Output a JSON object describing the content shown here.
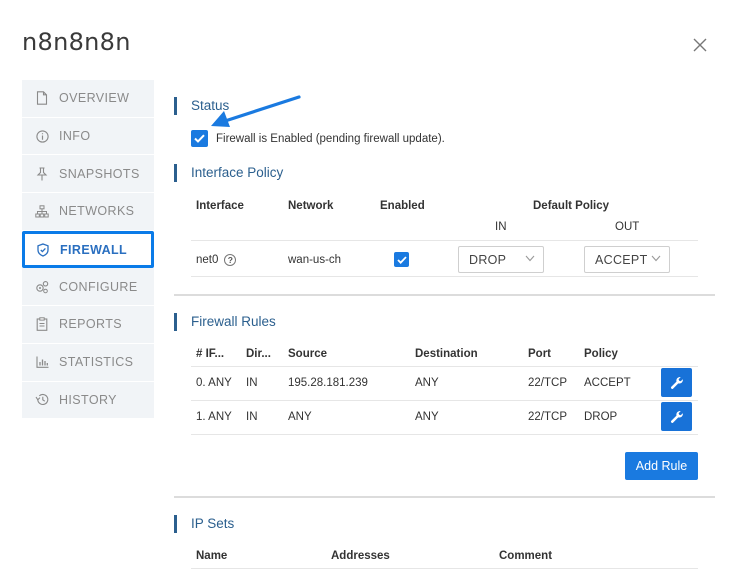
{
  "window": {
    "title": "n8n8n8n"
  },
  "sidebar": {
    "items": [
      {
        "label": "OVERVIEW",
        "icon": "document-icon"
      },
      {
        "label": "INFO",
        "icon": "info-icon"
      },
      {
        "label": "SNAPSHOTS",
        "icon": "pin-icon"
      },
      {
        "label": "NETWORKS",
        "icon": "network-icon"
      },
      {
        "label": "FIREWALL",
        "icon": "shield-icon",
        "active": true
      },
      {
        "label": "CONFIGURE",
        "icon": "gears-icon"
      },
      {
        "label": "REPORTS",
        "icon": "clipboard-icon"
      },
      {
        "label": "STATISTICS",
        "icon": "bar-chart-icon"
      },
      {
        "label": "HISTORY",
        "icon": "history-icon"
      }
    ]
  },
  "status": {
    "heading": "Status",
    "checkbox_label": "Firewall is Enabled (pending firewall update).",
    "checked": true
  },
  "interface_policy": {
    "heading": "Interface Policy",
    "headers": {
      "interface": "Interface",
      "network": "Network",
      "enabled": "Enabled",
      "default_policy": "Default Policy",
      "in": "IN",
      "out": "OUT"
    },
    "rows": [
      {
        "interface": "net0",
        "network": "wan-us-ch",
        "enabled": true,
        "in": "DROP",
        "out": "ACCEPT"
      }
    ]
  },
  "firewall_rules": {
    "heading": "Firewall Rules",
    "headers": {
      "index": "# IF...",
      "direction": "Dir...",
      "source": "Source",
      "destination": "Destination",
      "port": "Port",
      "policy": "Policy"
    },
    "rows": [
      {
        "index": "0. ANY",
        "direction": "IN",
        "source": "195.28.181.239",
        "destination": "ANY",
        "port": "22/TCP",
        "policy": "ACCEPT"
      },
      {
        "index": "1. ANY",
        "direction": "IN",
        "source": "ANY",
        "destination": "ANY",
        "port": "22/TCP",
        "policy": "DROP"
      }
    ],
    "add_button": "Add Rule"
  },
  "ip_sets": {
    "heading": "IP Sets",
    "headers": {
      "name": "Name",
      "addresses": "Addresses",
      "comment": "Comment"
    }
  },
  "colors": {
    "accent": "#1a7ae0",
    "heading": "#2b5f8e",
    "sidebar_bg": "#f1f4f7"
  }
}
